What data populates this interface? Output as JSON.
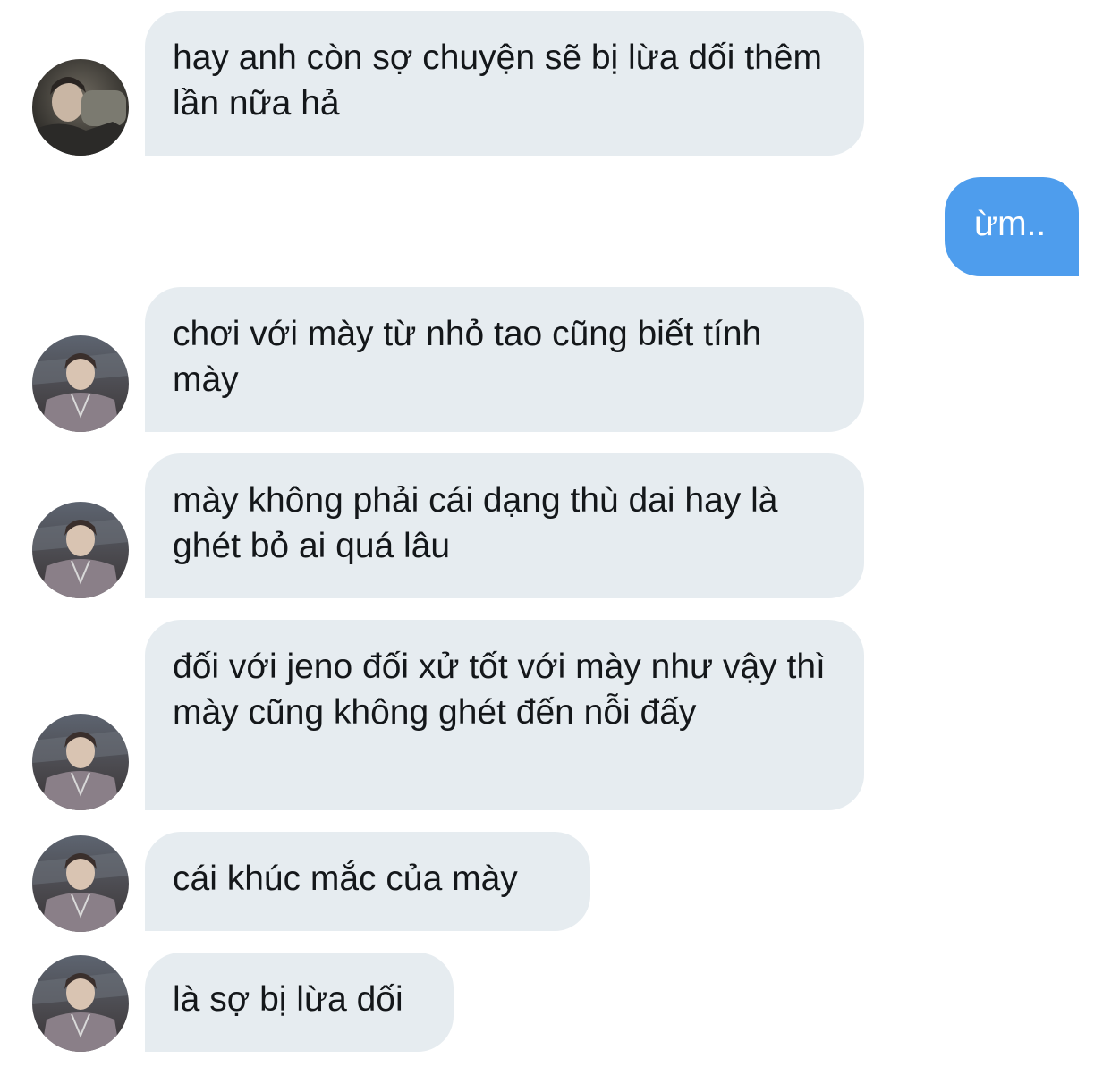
{
  "conversation": {
    "messages": [
      {
        "sender": "other",
        "avatar": "avatar-1",
        "text": "hay anh còn sợ chuyện sẽ bị lừa dối thêm lần nữa hả"
      },
      {
        "sender": "me",
        "text": "ừm.."
      },
      {
        "sender": "other",
        "avatar": "avatar-2",
        "text": "chơi với mày từ nhỏ tao cũng biết tính mày"
      },
      {
        "sender": "other",
        "avatar": "avatar-2",
        "text": "mày không phải cái dạng thù dai hay là ghét bỏ ai quá lâu"
      },
      {
        "sender": "other",
        "avatar": "avatar-2",
        "text": "đối với jeno đối xử tốt với mày như vậy thì mày cũng không ghét đến nỗi đấy"
      },
      {
        "sender": "other",
        "avatar": "avatar-2",
        "text": "cái khúc mắc của mày"
      },
      {
        "sender": "other",
        "avatar": "avatar-2",
        "text": "là sợ bị lừa dối"
      }
    ]
  },
  "colors": {
    "incoming_bubble": "#e6ecf0",
    "outgoing_bubble": "#4e9ded",
    "incoming_text": "#14171a",
    "outgoing_text": "#ffffff"
  }
}
